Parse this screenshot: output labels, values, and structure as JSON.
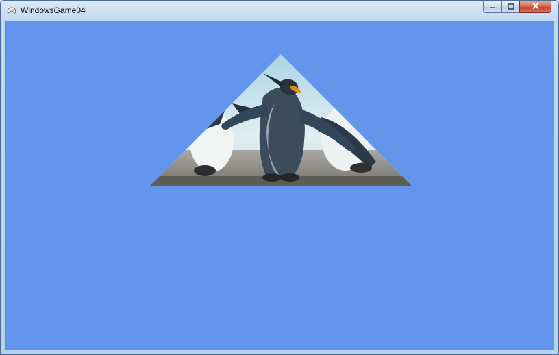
{
  "window": {
    "title": "WindowsGame04",
    "icon": "gamepad-icon",
    "buttons": {
      "minimize": "minimize-icon",
      "maximize": "maximize-icon",
      "close": "close-icon"
    }
  },
  "viewport": {
    "background_color": "#6495ED",
    "shape": "triangle",
    "texture": "penguins"
  }
}
